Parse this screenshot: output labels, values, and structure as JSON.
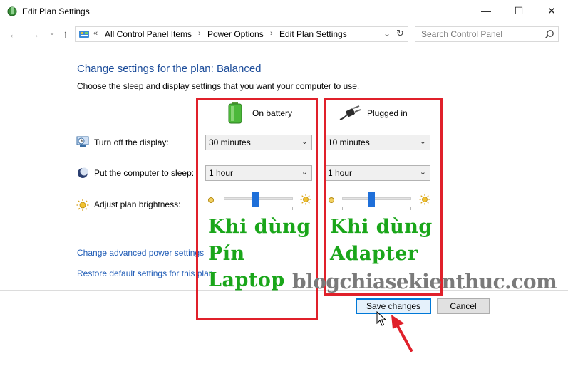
{
  "window": {
    "title": "Edit Plan Settings",
    "minimize": "—",
    "maximize": "☐",
    "close": "✕"
  },
  "nav": {
    "back": "←",
    "forward": "→",
    "dropdown": "⌄",
    "up": "↑"
  },
  "address": {
    "overflow": "«",
    "crumbs": [
      "All Control Panel Items",
      "Power Options",
      "Edit Plan Settings"
    ],
    "separator": "›",
    "dropdown": "⌄",
    "refresh": "↻"
  },
  "search": {
    "placeholder": "Search Control Panel"
  },
  "content": {
    "heading": "Change settings for the plan: Balanced",
    "subtext": "Choose the sleep and display settings that you want your computer to use.",
    "columns": {
      "battery": "On battery",
      "plugged": "Plugged in"
    },
    "rows": {
      "display_label": "Turn off the display:",
      "sleep_label": "Put the computer to sleep:",
      "brightness_label": "Adjust plan brightness:"
    },
    "display_battery": "30 minutes",
    "display_plugged": "10 minutes",
    "sleep_battery": "1 hour",
    "sleep_plugged": "1 hour",
    "brightness_battery_level": 0.45,
    "brightness_plugged_level": 0.42,
    "links": {
      "advanced": "Change advanced power settings",
      "restore": "Restore default settings for this plan"
    },
    "buttons": {
      "save": "Save changes",
      "cancel": "Cancel"
    }
  },
  "annotations": {
    "battery_text": [
      "Khi dùng",
      "Pín",
      "Laptop"
    ],
    "adapter_text": [
      "Khi dùng",
      "Adapter"
    ],
    "watermark": "blogchiasekienthuc.com",
    "box_color": "#e0202a",
    "text_color": "#1aa61a"
  },
  "colors": {
    "heading": "#1e4e9b",
    "link": "#1e5bb6",
    "slider_thumb": "#1e6fd9"
  }
}
